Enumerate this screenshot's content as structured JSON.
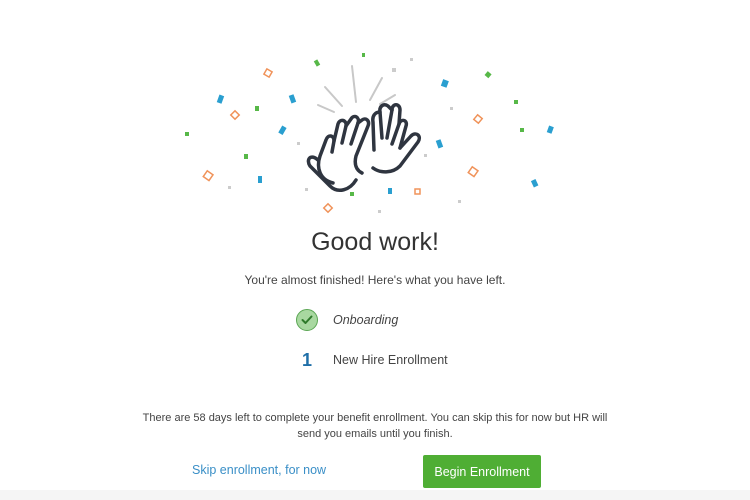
{
  "header": {
    "title": "Good work!",
    "subtitle": "You're almost finished! Here's what you have left."
  },
  "illustration": {
    "icon": "high-five-hands-icon",
    "confetti_colors": [
      "#2a9fd0",
      "#f0935a",
      "#57b848",
      "#cccccc"
    ]
  },
  "steps": [
    {
      "marker": "check-icon",
      "label": "Onboarding",
      "status": "completed"
    },
    {
      "marker": "1",
      "label": "New Hire Enrollment",
      "status": "pending"
    }
  ],
  "notice": "There are 58 days left to complete your benefit enrollment. You can skip this for now but HR will send you emails until you finish.",
  "actions": {
    "skip_label": "Skip enrollment, for now",
    "begin_label": "Begin Enrollment"
  },
  "colors": {
    "accent_green": "#4fae34",
    "link_blue": "#3a8fc7",
    "step_number_blue": "#1f6fa8"
  }
}
